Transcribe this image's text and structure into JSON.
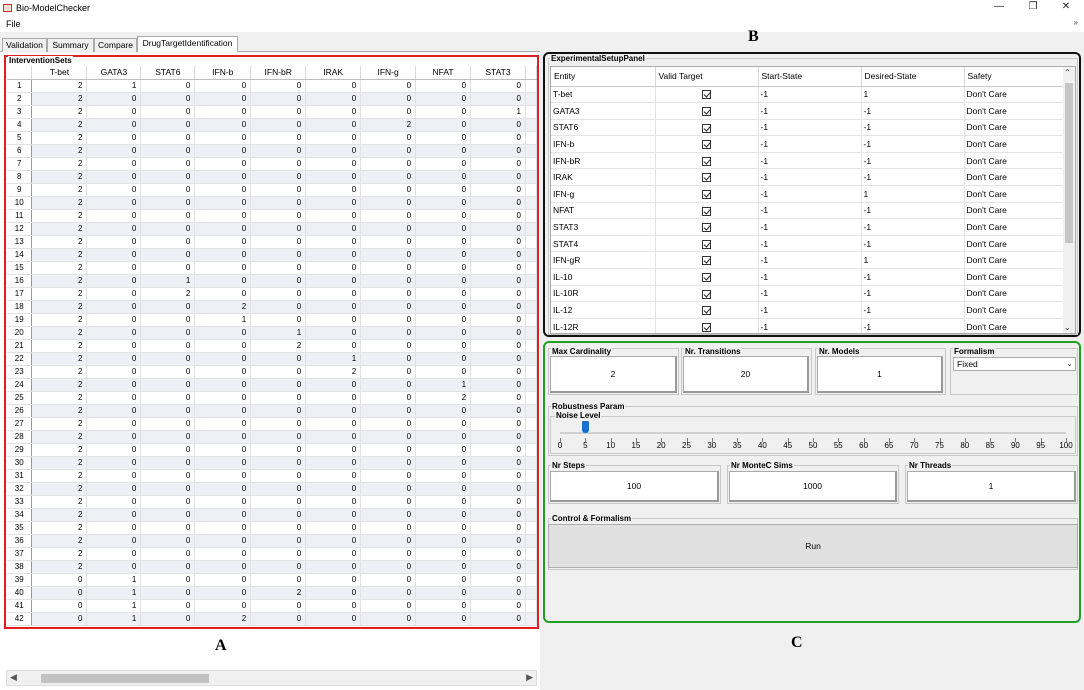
{
  "window": {
    "title": "Bio-ModelChecker",
    "minimize": "—",
    "restore": "❐",
    "close": "✕"
  },
  "menu": {
    "file": "File",
    "overflow": "»"
  },
  "tabs": [
    {
      "label": "Validation",
      "active": false
    },
    {
      "label": "Summary",
      "active": false
    },
    {
      "label": "Compare",
      "active": false
    },
    {
      "label": "DrugTargetIdentification",
      "active": true
    }
  ],
  "intervention": {
    "title": "InterventionSets",
    "columns": [
      "T-bet",
      "GATA3",
      "STAT6",
      "IFN-b",
      "IFN-bR",
      "IRAK",
      "IFN-g",
      "NFAT",
      "STAT3"
    ],
    "rows": [
      [
        2,
        1,
        0,
        0,
        0,
        0,
        0,
        0,
        0
      ],
      [
        2,
        0,
        0,
        0,
        0,
        0,
        0,
        0,
        0
      ],
      [
        2,
        0,
        0,
        0,
        0,
        0,
        0,
        0,
        1
      ],
      [
        2,
        0,
        0,
        0,
        0,
        0,
        2,
        0,
        0
      ],
      [
        2,
        0,
        0,
        0,
        0,
        0,
        0,
        0,
        0
      ],
      [
        2,
        0,
        0,
        0,
        0,
        0,
        0,
        0,
        0
      ],
      [
        2,
        0,
        0,
        0,
        0,
        0,
        0,
        0,
        0
      ],
      [
        2,
        0,
        0,
        0,
        0,
        0,
        0,
        0,
        0
      ],
      [
        2,
        0,
        0,
        0,
        0,
        0,
        0,
        0,
        0
      ],
      [
        2,
        0,
        0,
        0,
        0,
        0,
        0,
        0,
        0
      ],
      [
        2,
        0,
        0,
        0,
        0,
        0,
        0,
        0,
        0
      ],
      [
        2,
        0,
        0,
        0,
        0,
        0,
        0,
        0,
        0
      ],
      [
        2,
        0,
        0,
        0,
        0,
        0,
        0,
        0,
        0
      ],
      [
        2,
        0,
        0,
        0,
        0,
        0,
        0,
        0,
        0
      ],
      [
        2,
        0,
        0,
        0,
        0,
        0,
        0,
        0,
        0
      ],
      [
        2,
        0,
        1,
        0,
        0,
        0,
        0,
        0,
        0
      ],
      [
        2,
        0,
        2,
        0,
        0,
        0,
        0,
        0,
        0
      ],
      [
        2,
        0,
        0,
        2,
        0,
        0,
        0,
        0,
        0
      ],
      [
        2,
        0,
        0,
        1,
        0,
        0,
        0,
        0,
        0
      ],
      [
        2,
        0,
        0,
        0,
        1,
        0,
        0,
        0,
        0
      ],
      [
        2,
        0,
        0,
        0,
        2,
        0,
        0,
        0,
        0
      ],
      [
        2,
        0,
        0,
        0,
        0,
        1,
        0,
        0,
        0
      ],
      [
        2,
        0,
        0,
        0,
        0,
        2,
        0,
        0,
        0
      ],
      [
        2,
        0,
        0,
        0,
        0,
        0,
        0,
        1,
        0
      ],
      [
        2,
        0,
        0,
        0,
        0,
        0,
        0,
        2,
        0
      ],
      [
        2,
        0,
        0,
        0,
        0,
        0,
        0,
        0,
        0
      ],
      [
        2,
        0,
        0,
        0,
        0,
        0,
        0,
        0,
        0
      ],
      [
        2,
        0,
        0,
        0,
        0,
        0,
        0,
        0,
        0
      ],
      [
        2,
        0,
        0,
        0,
        0,
        0,
        0,
        0,
        0
      ],
      [
        2,
        0,
        0,
        0,
        0,
        0,
        0,
        0,
        0
      ],
      [
        2,
        0,
        0,
        0,
        0,
        0,
        0,
        0,
        0
      ],
      [
        2,
        0,
        0,
        0,
        0,
        0,
        0,
        0,
        0
      ],
      [
        2,
        0,
        0,
        0,
        0,
        0,
        0,
        0,
        0
      ],
      [
        2,
        0,
        0,
        0,
        0,
        0,
        0,
        0,
        0
      ],
      [
        2,
        0,
        0,
        0,
        0,
        0,
        0,
        0,
        0
      ],
      [
        2,
        0,
        0,
        0,
        0,
        0,
        0,
        0,
        0
      ],
      [
        2,
        0,
        0,
        0,
        0,
        0,
        0,
        0,
        0
      ],
      [
        2,
        0,
        0,
        0,
        0,
        0,
        0,
        0,
        0
      ],
      [
        0,
        1,
        0,
        0,
        0,
        0,
        0,
        0,
        0
      ],
      [
        0,
        1,
        0,
        0,
        2,
        0,
        0,
        0,
        0
      ],
      [
        0,
        1,
        0,
        0,
        0,
        0,
        0,
        0,
        0
      ],
      [
        0,
        1,
        0,
        2,
        0,
        0,
        0,
        0,
        0
      ]
    ]
  },
  "experimental": {
    "title": "ExperimentalSetupPanel",
    "columns": [
      "Entity",
      "Valid Target",
      "Start-State",
      "Desired-State",
      "Safety"
    ],
    "rows": [
      [
        "T-bet",
        true,
        "-1",
        "1",
        "Don't Care"
      ],
      [
        "GATA3",
        true,
        "-1",
        "-1",
        "Don't Care"
      ],
      [
        "STAT6",
        true,
        "-1",
        "-1",
        "Don't Care"
      ],
      [
        "IFN-b",
        true,
        "-1",
        "-1",
        "Don't Care"
      ],
      [
        "IFN-bR",
        true,
        "-1",
        "-1",
        "Don't Care"
      ],
      [
        "IRAK",
        true,
        "-1",
        "-1",
        "Don't Care"
      ],
      [
        "IFN-g",
        true,
        "-1",
        "1",
        "Don't Care"
      ],
      [
        "NFAT",
        true,
        "-1",
        "-1",
        "Don't Care"
      ],
      [
        "STAT3",
        true,
        "-1",
        "-1",
        "Don't Care"
      ],
      [
        "STAT4",
        true,
        "-1",
        "-1",
        "Don't Care"
      ],
      [
        "IFN-gR",
        true,
        "-1",
        "1",
        "Don't Care"
      ],
      [
        "IL-10",
        true,
        "-1",
        "-1",
        "Don't Care"
      ],
      [
        "IL-10R",
        true,
        "-1",
        "-1",
        "Don't Care"
      ],
      [
        "IL-12",
        true,
        "-1",
        "-1",
        "Don't Care"
      ],
      [
        "IL-12R",
        true,
        "-1",
        "-1",
        "Don't Care"
      ]
    ]
  },
  "params": {
    "max_cardinality_label": "Max Cardinality",
    "max_cardinality": "2",
    "nr_transitions_label": "Nr. Transitions",
    "nr_transitions": "20",
    "nr_models_label": "Nr. Models",
    "nr_models": "1",
    "formalism_label": "Formalism",
    "formalism": "Fixed",
    "robustness_label": "Robustness Param",
    "noise_label": "Noise Level",
    "noise_value": 5,
    "noise_ticks": [
      "0",
      "5",
      "10",
      "15",
      "20",
      "25",
      "30",
      "35",
      "40",
      "45",
      "50",
      "55",
      "60",
      "65",
      "70",
      "75",
      "80",
      "85",
      "90",
      "95",
      "100"
    ],
    "nr_steps_label": "Nr Steps",
    "nr_steps": "100",
    "nr_montec_label": "Nr MonteC Sims",
    "nr_montec": "1000",
    "nr_threads_label": "Nr Threads",
    "nr_threads": "1",
    "control_label": "Control & Formalism",
    "run_label": "Run"
  },
  "figure_labels": {
    "a": "A",
    "b": "B",
    "c": "C"
  },
  "colors": {
    "panel_a": "#e02020",
    "panel_b": "#111111",
    "panel_c": "#23a023",
    "slider": "#1a6fd1"
  }
}
